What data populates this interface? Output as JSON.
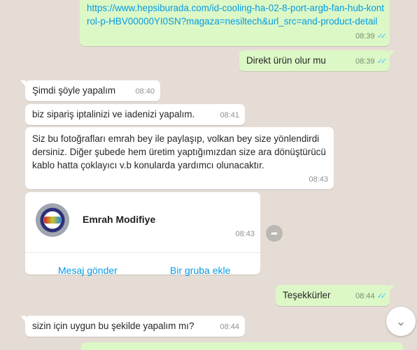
{
  "messages": [
    {
      "direction": "out",
      "text": "https://www.hepsiburada.com/id-cooling-ha-02-8-port-argb-fan-hub-kontrol-p-HBV00000YI0SN?magaza=nesiltech&url_src=and-product-detail",
      "time": "08:39",
      "read": true
    },
    {
      "direction": "out",
      "text": "Direkt ürün olur mu",
      "time": "08:39",
      "read": true
    },
    {
      "direction": "in",
      "text": "Şimdi şöyle yapalım",
      "time": "08:40"
    },
    {
      "direction": "in",
      "text": "biz sipariş iptalinizi ve iadenizi yapalım.",
      "time": "08:41"
    },
    {
      "direction": "in",
      "text": "Siz bu fotoğrafları emrah bey ile paylaşıp, volkan bey size yönlendirdi dersiniz. Diğer şubede hem üretim yaptığımızdan size ara dönüştürücü kablo hatta çoklayıcı v.b konularda yardımcı olunacaktır.",
      "time": "08:43"
    },
    {
      "direction": "in",
      "type": "contact",
      "contact_name": "Emrah Modifiye",
      "time": "08:43",
      "actions": [
        "Mesaj gönder",
        "Bir gruba ekle"
      ]
    },
    {
      "direction": "out",
      "text": "Teşekkürler",
      "time": "08:44",
      "read": true
    },
    {
      "direction": "in",
      "text": "sizin için uygun bu şekilde yapalım mı?",
      "time": "08:44"
    }
  ],
  "icons": {
    "share": "share-arrow-icon",
    "scroll": "chevron-down-icon",
    "read_ticks": "double-check-icon"
  },
  "colors": {
    "chat_background": "#e5ddd5",
    "outgoing_bubble": "#dcf8c6",
    "incoming_bubble": "#ffffff",
    "link": "#039be5",
    "read_ticks": "#4fc3f7"
  }
}
